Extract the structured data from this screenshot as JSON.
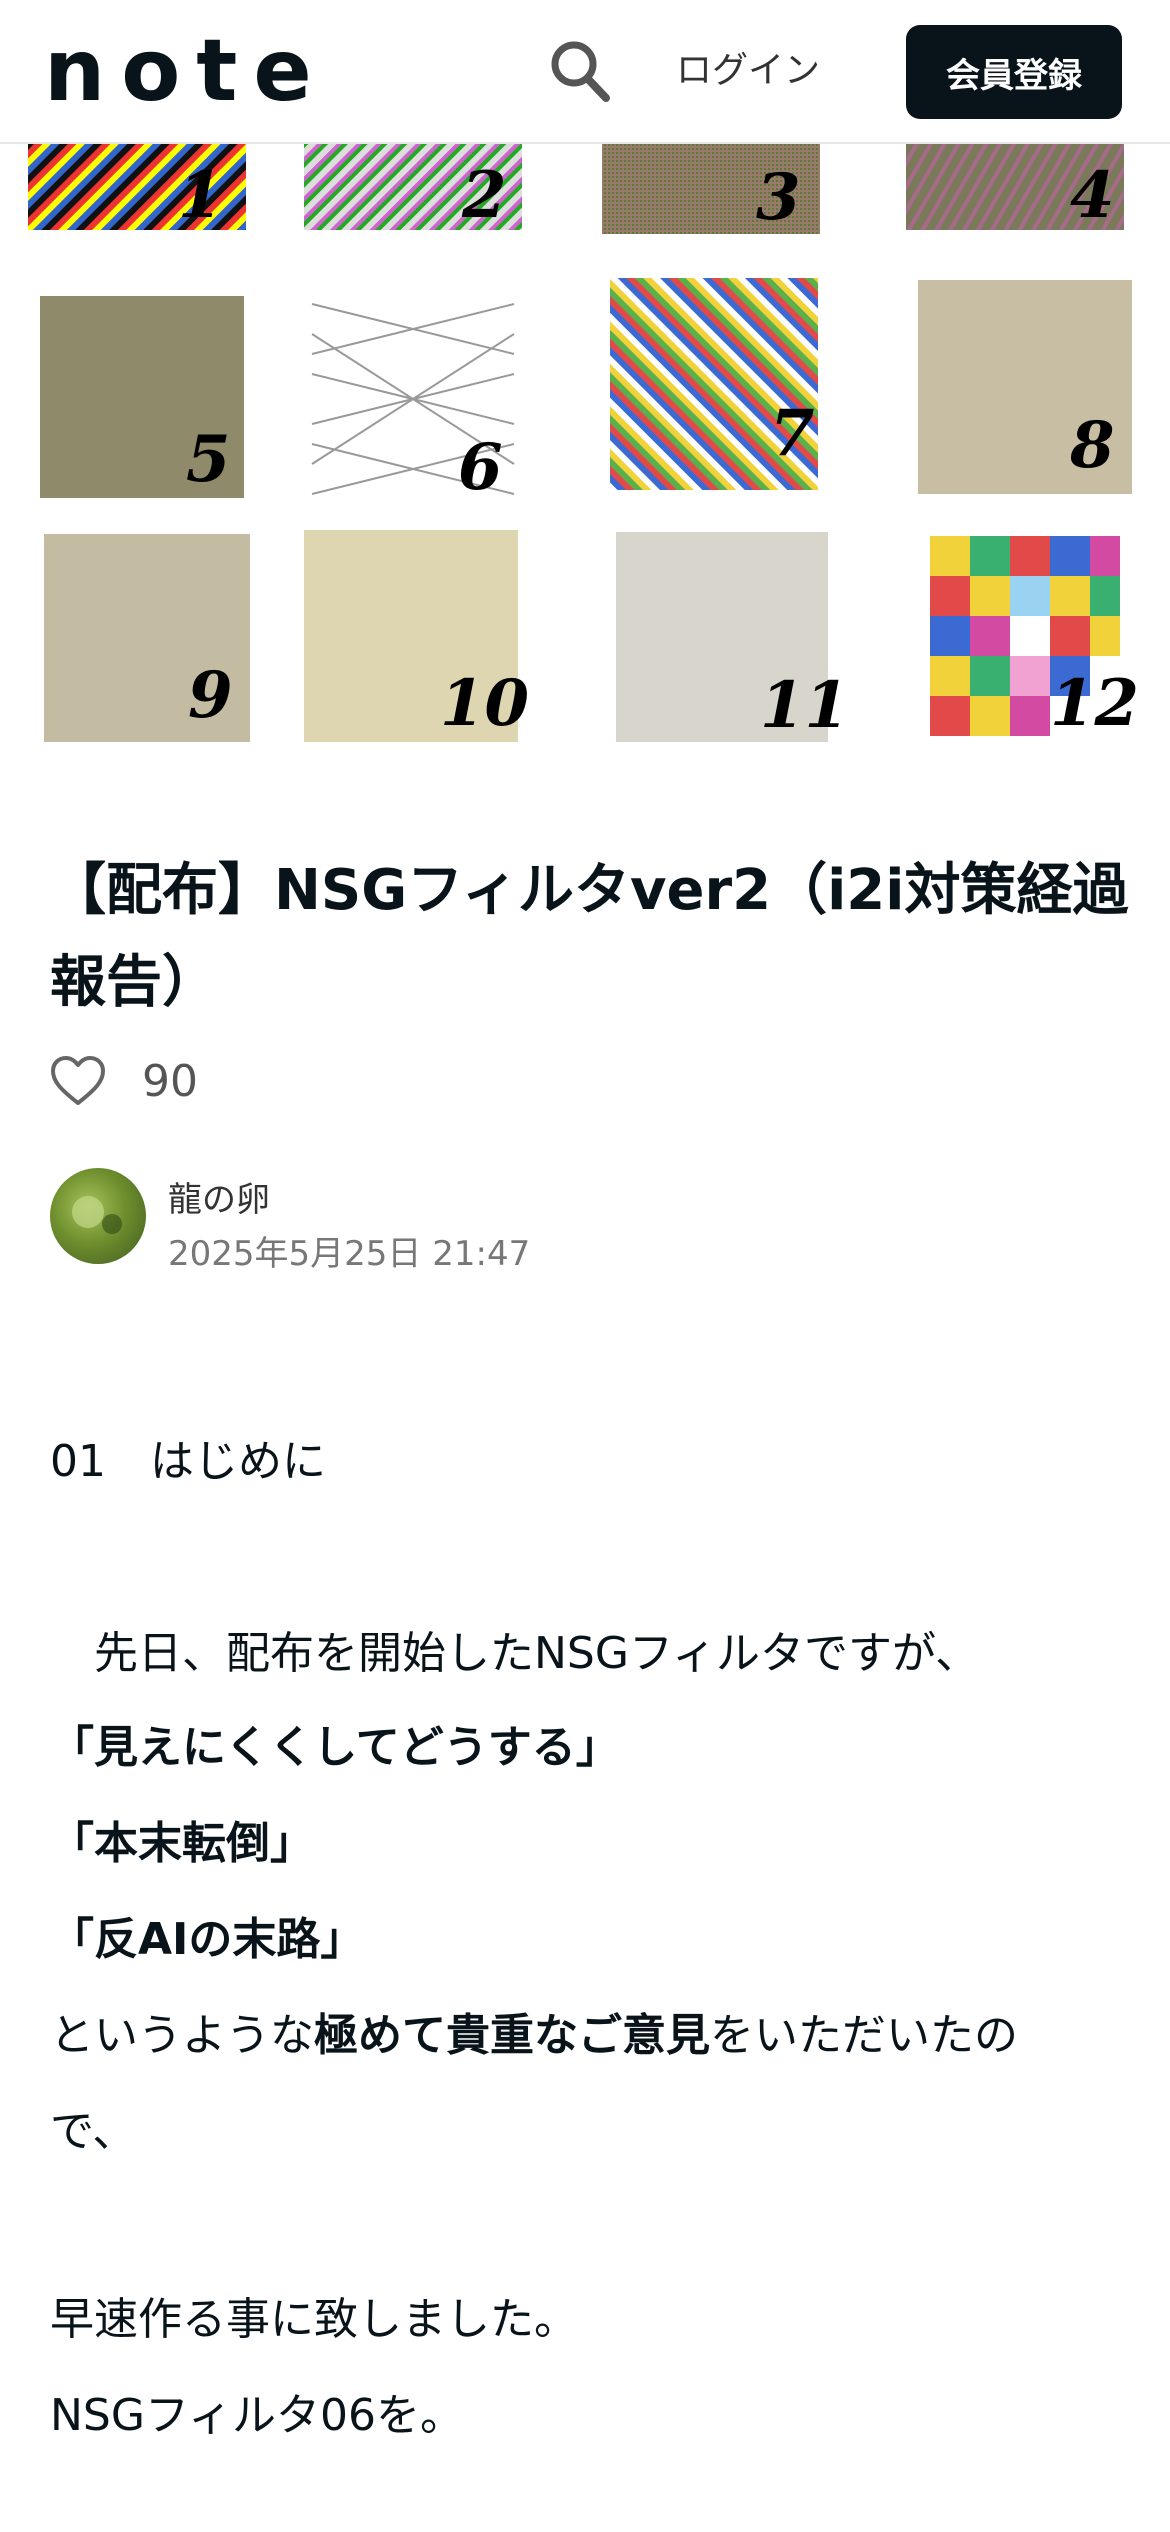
{
  "header": {
    "logo_text": "note",
    "search_icon": "search-icon",
    "login_label": "ログイン",
    "signup_label": "会員登録"
  },
  "hero": {
    "tile_labels": [
      "1",
      "2",
      "3",
      "4",
      "5",
      "6",
      "7",
      "8",
      "9",
      "10",
      "11",
      "12"
    ]
  },
  "article": {
    "title": "【配布】NSGフィルタver2（i2i対策経過報告）",
    "like_count": "90",
    "author": "龍の卵",
    "date": "2025年5月25日 21:47",
    "section_heading": "01　はじめに",
    "p1": "　先日、配布を開始したNSGフィルタですが、",
    "q1": "「見えにくくしてどうする」",
    "q2": "「本末転倒」",
    "q3": "「反AIの末路」",
    "p2_pre": "というような",
    "p2_bold": "極めて貴重なご意見",
    "p2_post": "をいただいたの",
    "p2_cont": "で、",
    "p3": "早速作る事に致しました。",
    "p4": "NSGフィルタ06を。"
  },
  "colors": {
    "text": "#08131a",
    "signup_bg": "#08131a",
    "muted": "#777777"
  }
}
